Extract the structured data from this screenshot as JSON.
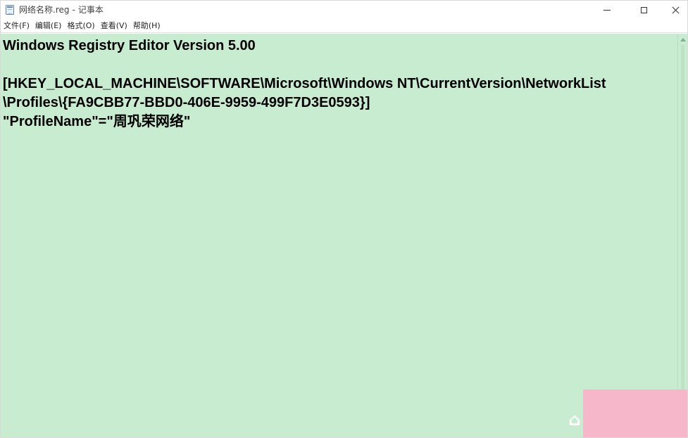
{
  "window": {
    "file_name": "网络名称.reg",
    "separator": "-",
    "app_name": "记事本"
  },
  "menu": [
    {
      "label": "文件(F)"
    },
    {
      "label": "编辑(E)"
    },
    {
      "label": "格式(O)"
    },
    {
      "label": "查看(V)"
    },
    {
      "label": "帮助(H)"
    }
  ],
  "editor": {
    "background": "#c8ecd0",
    "lines": [
      "Windows Registry Editor Version 5.00",
      "",
      "[HKEY_LOCAL_MACHINE\\SOFTWARE\\Microsoft\\Windows NT\\CurrentVersion\\NetworkList",
      "\\Profiles\\{FA9CBB77-BBD0-406E-9959-499F7D3E0593}]",
      "\"ProfileName\"=\"周巩荣网络\""
    ]
  },
  "icons": {
    "app": "notepad-icon",
    "minimize": "minimize-icon",
    "maximize": "maximize-icon",
    "close": "close-icon"
  },
  "colors": {
    "watermark": "#f7b7cb"
  }
}
